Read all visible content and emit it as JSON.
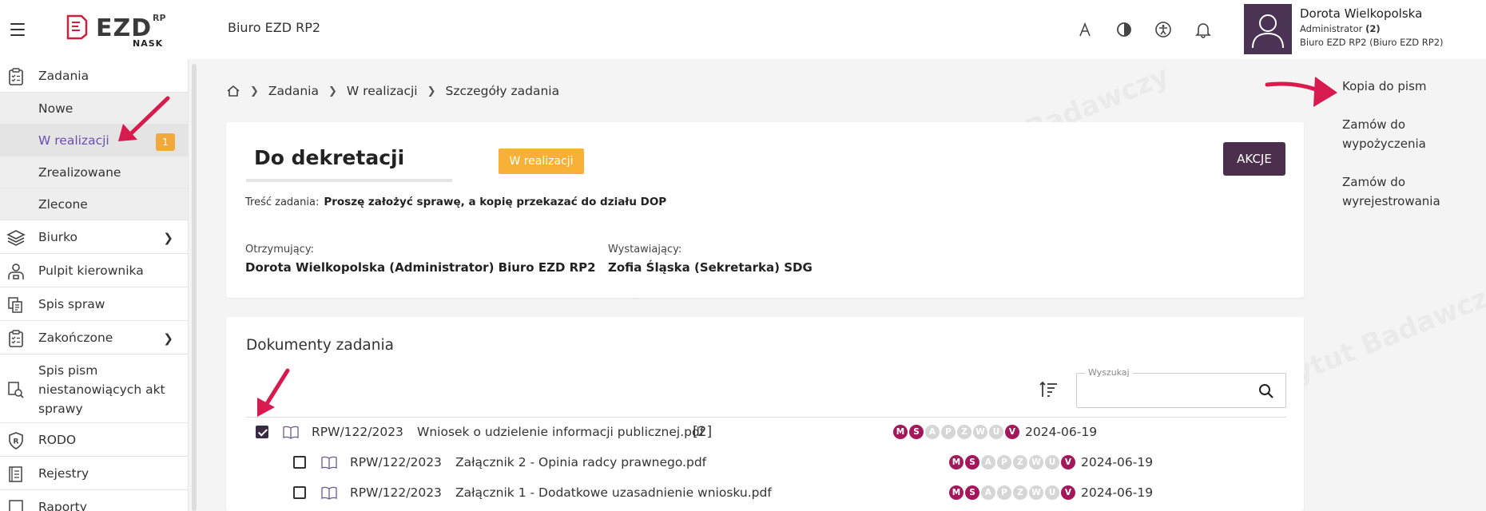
{
  "header": {
    "logo_text": "EZD",
    "logo_rp": "RP",
    "logo_nask": "NASK",
    "office_name": "Biuro EZD RP2",
    "user": {
      "name": "Dorota Wielkopolska",
      "role": "Administrator",
      "role_count": "(2)",
      "office": "Biuro EZD RP2 (Biuro EZD RP2)"
    }
  },
  "sidebar": {
    "zadania": "Zadania",
    "sub": {
      "nowe": "Nowe",
      "w_realizacji": "W realizacji",
      "w_realizacji_badge": "1",
      "zrealizowane": "Zrealizowane",
      "zlecone": "Zlecone"
    },
    "biurko": "Biurko",
    "pulpit": "Pulpit kierownika",
    "spis_spraw": "Spis spraw",
    "zakonczone": "Zakończone",
    "spis_pism": "Spis pism niestanowiących akt sprawy",
    "rodo": "RODO",
    "rejestry": "Rejestry",
    "raporty": "Raporty"
  },
  "breadcrumb": {
    "zadania": "Zadania",
    "w_realizacji": "W realizacji",
    "szczegoly": "Szczegóły zadania"
  },
  "task": {
    "title": "Do dekretacji",
    "status": "W realizacji",
    "actions_label": "AKCJE",
    "content_label": "Treść zadania:",
    "content": "Proszę założyć sprawę, a kopię przekazać do działu DOP",
    "recipient_label": "Otrzymujący:",
    "recipient": "Dorota Wielkopolska (Administrator) Biuro EZD RP2",
    "issuer_label": "Wystawiający:",
    "issuer": "Zofia Śląska (Sekretarka) SDG"
  },
  "documents": {
    "title": "Dokumenty zadania",
    "search_label": "Wyszukaj",
    "search_value": "",
    "rows": [
      {
        "signature": "RPW/122/2023",
        "name": "Wniosek o udzielenie informacji publicznej.pdf",
        "count": "[2]",
        "date": "2024-06-19",
        "checked": true
      },
      {
        "signature": "RPW/122/2023",
        "name": "Załącznik 2 - Opinia radcy prawnego.pdf",
        "count": "",
        "date": "2024-06-19",
        "checked": false
      },
      {
        "signature": "RPW/122/2023",
        "name": "Załącznik 1 - Dodatkowe uzasadnienie wniosku.pdf",
        "count": "",
        "date": "2024-06-19",
        "checked": false
      }
    ],
    "markers": [
      "M",
      "S",
      "A",
      "P",
      "Z",
      "W",
      "U",
      "V"
    ],
    "marker_states": [
      "on",
      "on",
      "off",
      "off",
      "off",
      "off",
      "off",
      "on"
    ]
  },
  "right_panel": {
    "kopia": "Kopia do pism",
    "zamow_wyp": "Zamów do wypożyczenia",
    "zamow_wyr": "Zamów do wyrejestrowania"
  },
  "watermark": "NASK – Państwowy Instytut Badawczy",
  "colors": {
    "brand_purple": "#4c2f4d",
    "status_orange": "#f7b137",
    "marker_on": "#a3175b",
    "marker_off": "#d6d6d6",
    "active_link": "#6a50b5",
    "annotation_arrow": "#d81b4f"
  }
}
